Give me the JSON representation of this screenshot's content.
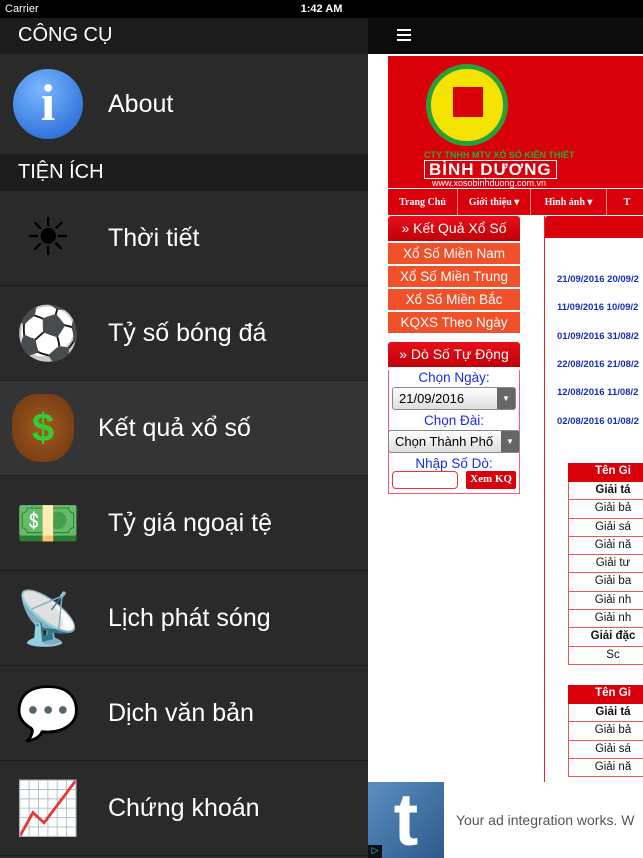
{
  "status": {
    "carrier": "Carrier",
    "time": "1:42 AM"
  },
  "sidebar": {
    "header": "CÔNG CỤ",
    "about": {
      "label": "About",
      "icon": "info-icon"
    },
    "section": "TIỆN ÍCH",
    "items": [
      {
        "label": "Thời tiết",
        "icon": "sun-icon",
        "glyph": "☀"
      },
      {
        "label": "Tỷ số bóng đá",
        "icon": "soccer-ball-icon",
        "glyph": "⚽"
      },
      {
        "label": "Kết quả xổ số",
        "icon": "money-bag-icon",
        "glyph": "$",
        "selected": true
      },
      {
        "label": "Tỷ giá ngoại tệ",
        "icon": "cash-icon",
        "glyph": "💵"
      },
      {
        "label": "Lịch phát sóng",
        "icon": "broadcast-icon",
        "glyph": "📡"
      },
      {
        "label": "Dịch văn bản",
        "icon": "speech-icon",
        "glyph": "💬"
      },
      {
        "label": "Chứng khoán",
        "icon": "stock-chart-icon",
        "glyph": "📈"
      }
    ]
  },
  "web": {
    "banner": {
      "company": "CTY TNHH MTV XỔ SỐ KIẾN THIẾT",
      "name": "BÌNH DƯƠNG",
      "url": "www.xosobinhduong.com.vn"
    },
    "nav": [
      "Trang Chủ",
      "Giới thiệu ▾",
      "Hình ảnh ▾",
      "T"
    ],
    "results_box": {
      "title": "» Kết Quả Xổ Số",
      "items": [
        "Xổ Số Miền Nam",
        "Xổ Số Miền Trung",
        "Xổ Số Miền Bắc",
        "KQXS Theo Ngày"
      ]
    },
    "auto_check": {
      "title": "» Dò Số Tự Động",
      "date_label": "Chọn Ngày:",
      "date_value": "21/09/2016",
      "station_label": "Chọn Đài:",
      "station_value": "Chọn Thành Phố",
      "number_label": "Nhập Số Dò:",
      "number_value": "",
      "submit": "Xem KQ"
    },
    "dates": [
      "21/09/2016 20/09/2",
      "11/09/2016 10/09/2",
      "01/09/2016 31/08/2",
      "22/08/2016 21/08/2",
      "12/08/2016 11/08/2",
      "02/08/2016 01/08/2"
    ],
    "table1": [
      "Tên Gi",
      "Giải tá",
      "Giải bả",
      "Giải sá",
      "Giải nă",
      "Giải tư",
      "Giải ba",
      "Giải nh",
      "Giải nh",
      "Giải đặc",
      "Sc"
    ],
    "table2": [
      "Tên Gi",
      "Giải tá",
      "Giải bả",
      "Giải sá",
      "Giải nă"
    ]
  },
  "ad": {
    "text": "Your ad integration works. W",
    "logo": "t"
  }
}
